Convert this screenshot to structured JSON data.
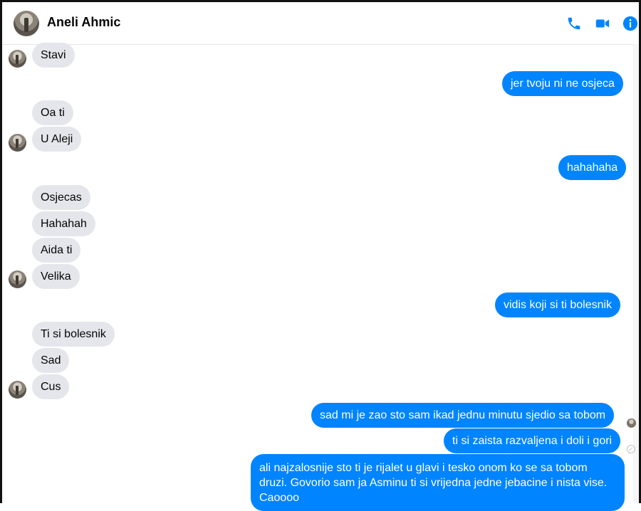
{
  "header": {
    "contact_name": "Aneli Ahmic",
    "icons": [
      "phone-icon",
      "video-camera-icon",
      "info-icon"
    ],
    "accent_color": "#0084ff"
  },
  "messages": [
    {
      "side": "in",
      "text": "Stavi"
    },
    {
      "side": "out",
      "text": "jer tvoju ni ne osjeca"
    },
    {
      "side": "in",
      "text": "Oa ti"
    },
    {
      "side": "in",
      "text": "U Aleji"
    },
    {
      "side": "out",
      "text": "hahahaha"
    },
    {
      "side": "in",
      "text": "Osjecas"
    },
    {
      "side": "in",
      "text": "Hahahah"
    },
    {
      "side": "in",
      "text": "Aida ti"
    },
    {
      "side": "in",
      "text": "Velika"
    },
    {
      "side": "out",
      "text": "vidis koji si ti bolesnik"
    },
    {
      "side": "in",
      "text": "Ti si bolesnik"
    },
    {
      "side": "in",
      "text": "Sad"
    },
    {
      "side": "in",
      "text": "Cus"
    },
    {
      "side": "out",
      "text": "sad mi je zao sto sam ikad jednu minutu sjedio sa tobom"
    },
    {
      "side": "out",
      "text": "ti si zaista razvaljena i doli i gori"
    },
    {
      "side": "out",
      "text": "ali najzalosnije sto ti je rijalet u glavi i tesko onom ko se sa tobom druzi. Govorio sam ja Asminu ti si vrijedna jedne jebacine i nista vise. Caoooo"
    }
  ],
  "colors": {
    "incoming_bubble": "#e4e6eb",
    "outgoing_bubble": "#0084ff"
  }
}
